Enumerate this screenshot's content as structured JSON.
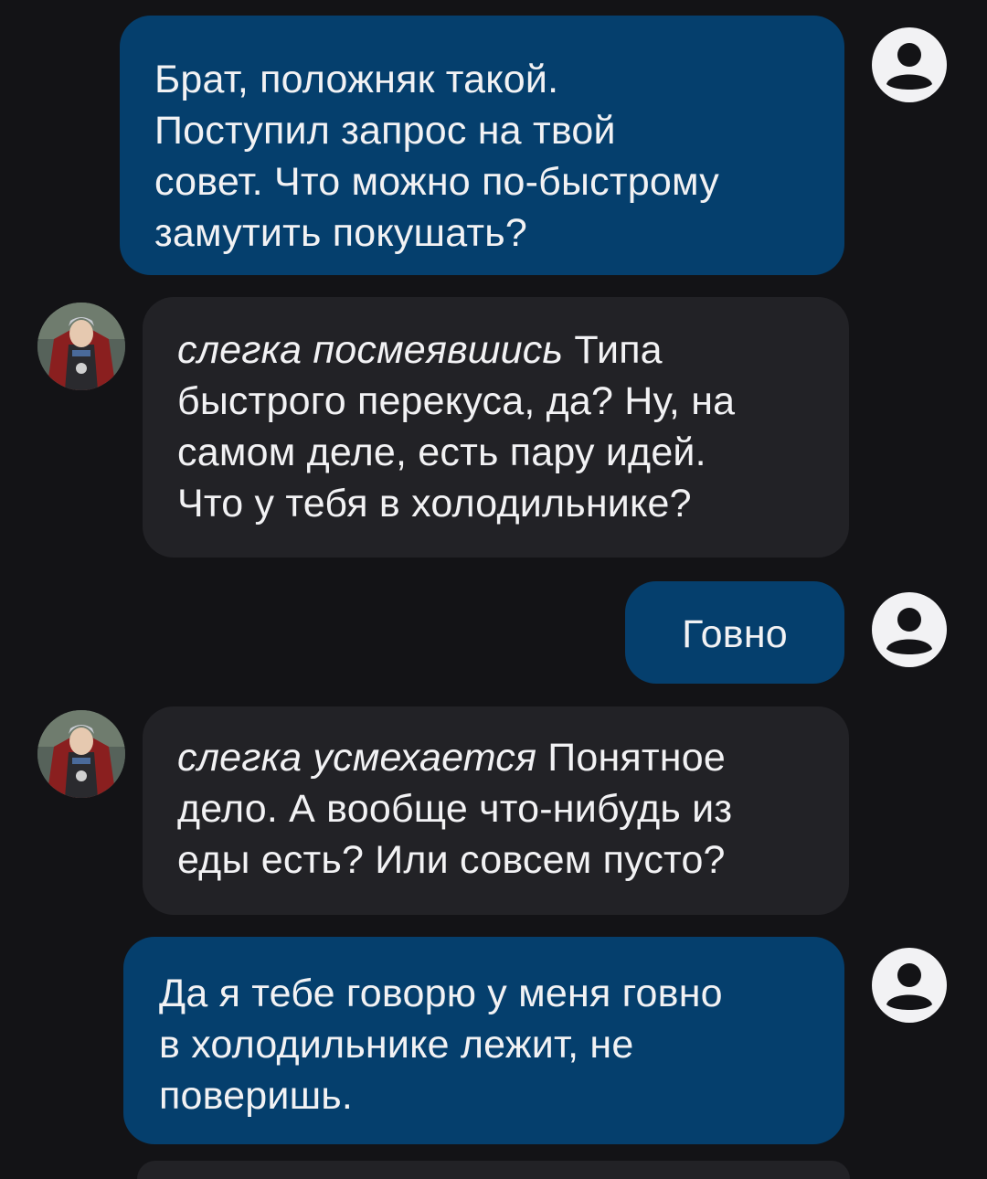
{
  "chat": {
    "messages": [
      {
        "role": "user",
        "text": "Брат, положняк такой. Поступил запрос на твой совет. Что можно по-быстрому замутить покушать?",
        "lines": [
          "Брат, положняк такой.",
          "Поступил запрос на твой",
          "совет. Что можно по-быстрому",
          "замутить покушать?"
        ]
      },
      {
        "role": "character",
        "action": "слегка посмеявшись",
        "lines": [
          {
            "action": "слегка посмеявшись",
            "text": " Типа"
          },
          {
            "text": "быстрого перекуса, да? Ну, на"
          },
          {
            "text": "самом деле, есть пару идей."
          },
          {
            "text": "Что у тебя в холодильнике?"
          }
        ]
      },
      {
        "role": "user",
        "lines": [
          "Говно"
        ]
      },
      {
        "role": "character",
        "lines": [
          {
            "action": "слегка усмехается",
            "text": " Понятное"
          },
          {
            "text": "дело. А вообще что-нибудь из"
          },
          {
            "text": "еды есть? Или совсем пусто?"
          }
        ]
      },
      {
        "role": "user",
        "lines": [
          "Да я тебе говорю у меня говно",
          "в холодильнике лежит, не",
          "поверишь."
        ]
      }
    ]
  },
  "colors": {
    "background": "#131316",
    "user_bubble": "#053f6d",
    "character_bubble": "#222226",
    "text": "#f2f2f4",
    "user_avatar_bg": "#f2f2f4"
  },
  "icons": {
    "user_avatar": "user-circle-icon",
    "character_avatar": "character-portrait"
  }
}
